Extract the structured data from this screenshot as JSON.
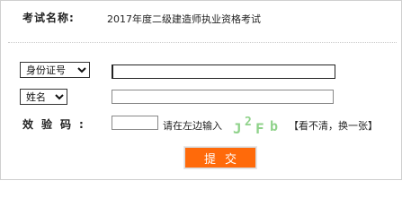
{
  "exam": {
    "label": "考试名称:",
    "name": "2017年度二级建造师执业资格考试"
  },
  "form": {
    "id_type": {
      "selected": "身份证号",
      "options": [
        "身份证号"
      ]
    },
    "id_number": {
      "value": ""
    },
    "name_type": {
      "selected": "姓名",
      "options": [
        "姓名"
      ]
    },
    "name": {
      "value": ""
    },
    "captcha": {
      "label": "效验码:",
      "value": "",
      "hint": "请在左边输入",
      "image_text": [
        "J",
        "2",
        "F",
        "b"
      ],
      "refresh_text": "【看不清，换一张】"
    },
    "submit_label": "提交"
  },
  "colors": {
    "submit_bg": "#ff6a0a",
    "captcha_text": "#8fd28a",
    "border": "#cfcfcf"
  }
}
